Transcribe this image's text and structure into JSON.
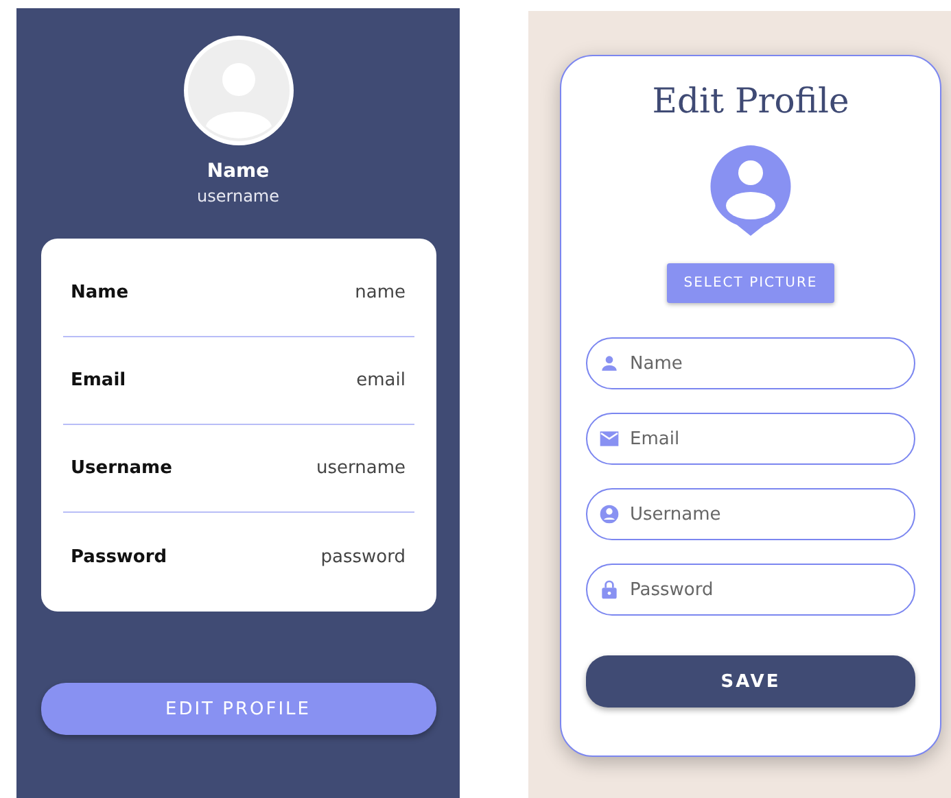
{
  "profile_screen": {
    "name": "Name",
    "username": "username",
    "details": [
      {
        "label": "Name",
        "value": "name"
      },
      {
        "label": "Email",
        "value": "email"
      },
      {
        "label": "Username",
        "value": "username"
      },
      {
        "label": "Password",
        "value": "password"
      }
    ],
    "button": "EDIT PROFILE"
  },
  "edit_screen": {
    "title": "Edit Profile",
    "select_button": "SELECT PICTURE",
    "fields": [
      {
        "kind": "person",
        "placeholder": "Name"
      },
      {
        "kind": "mail",
        "placeholder": "Email"
      },
      {
        "kind": "account",
        "placeholder": "Username"
      },
      {
        "kind": "lock",
        "placeholder": "Password"
      }
    ],
    "save_button": "SAVE"
  }
}
